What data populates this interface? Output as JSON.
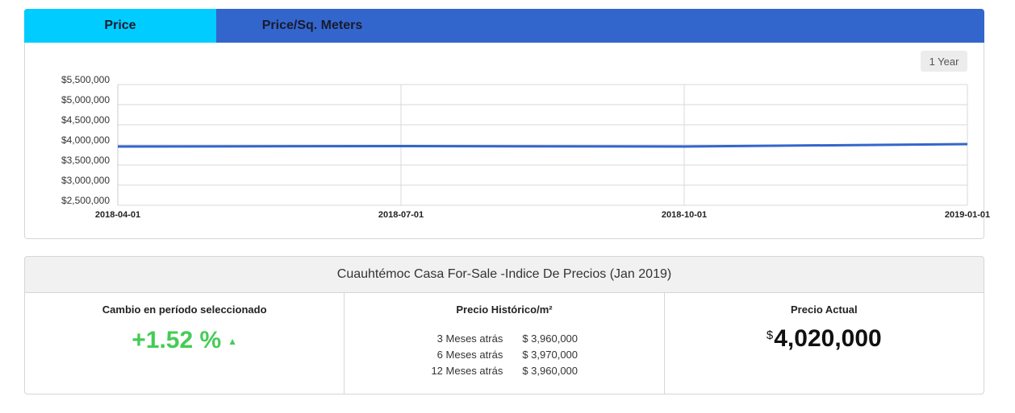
{
  "tabs": [
    {
      "label": "Price",
      "active": true
    },
    {
      "label": "Price/Sq. Meters",
      "active": false
    }
  ],
  "range_button": "1 Year",
  "colors": {
    "accent": "#3366cc",
    "active_tab": "#00ccff",
    "positive": "#44cc55",
    "line": "#3366cc"
  },
  "chart_data": {
    "type": "line",
    "x": [
      "2018-04-01",
      "2018-07-01",
      "2018-10-01",
      "2019-01-01"
    ],
    "series": [
      {
        "values": [
          3960000,
          3970000,
          3960000,
          4020000
        ]
      }
    ],
    "ylim": [
      2500000,
      5500000
    ],
    "yticks": [
      2500000,
      3000000,
      3500000,
      4000000,
      4500000,
      5000000,
      5500000
    ],
    "ytick_labels": [
      "$2,500,000",
      "$3,000,000",
      "$3,500,000",
      "$4,000,000",
      "$4,500,000",
      "$5,000,000",
      "$5,500,000"
    ],
    "xtick_labels": [
      "2018-04-01",
      "2018-07-01",
      "2018-10-01",
      "2019-01-01"
    ],
    "grid": true
  },
  "stats": {
    "header": "Cuauhtémoc Casa For-Sale -Indice De Precios (Jan 2019)",
    "change": {
      "title": "Cambio en período seleccionado",
      "value": "+1.52 %",
      "arrow": "▲"
    },
    "historic": {
      "title": "Precio Histórico/m²",
      "rows": [
        {
          "label": "3 Meses atrás",
          "value": "$ 3,960,000"
        },
        {
          "label": "6 Meses atrás",
          "value": "$ 3,970,000"
        },
        {
          "label": "12 Meses atrás",
          "value": "$ 3,960,000"
        }
      ]
    },
    "current": {
      "title": "Precio Actual",
      "currency": "$",
      "value": "4,020,000"
    }
  }
}
